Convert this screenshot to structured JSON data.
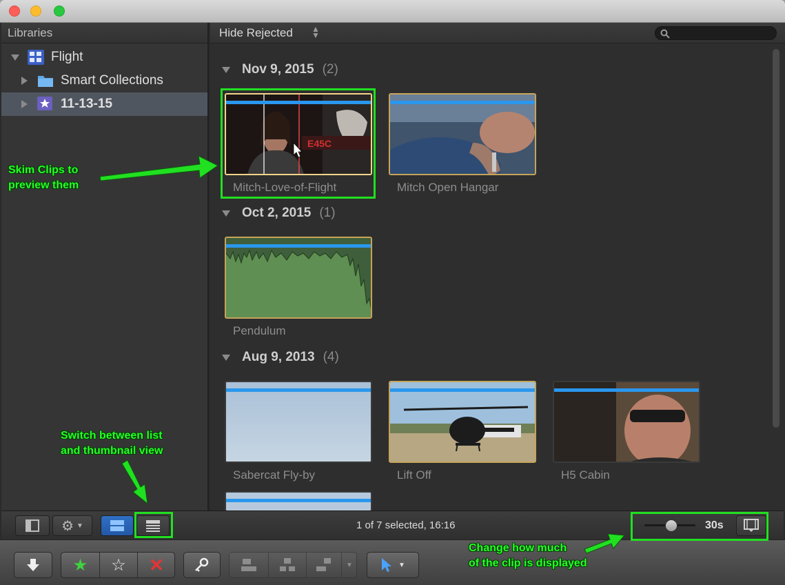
{
  "sidebar": {
    "header": "Libraries",
    "items": [
      {
        "label": "Flight",
        "icon": "library-icon",
        "expanded": true
      },
      {
        "label": "Smart Collections",
        "icon": "folder-icon",
        "expanded": false
      },
      {
        "label": "11-13-15",
        "icon": "event-star-icon",
        "expanded": false
      }
    ]
  },
  "browser": {
    "filter": "Hide Rejected",
    "search_placeholder": "",
    "groups": [
      {
        "date": "Nov 9, 2015",
        "count": "(2)",
        "clips": [
          "Mitch-Love-of-Flight",
          "Mitch Open Hangar"
        ]
      },
      {
        "date": "Oct 2, 2015",
        "count": "(1)",
        "clips": [
          "Pendulum"
        ]
      },
      {
        "date": "Aug 9, 2013",
        "count": "(4)",
        "clips": [
          "Sabercat Fly-by",
          "Lift Off",
          "H5 Cabin"
        ]
      }
    ]
  },
  "bottombar": {
    "status": "1 of 7 selected, 16:16",
    "duration": "30s"
  },
  "annotations": {
    "skim_line1": "Skim Clips to",
    "skim_line2": "preview them",
    "switch_line1": "Switch between list",
    "switch_line2": "and thumbnail view",
    "change_line1": "Change how much",
    "change_line2": "of the clip is displayed"
  },
  "colors": {
    "annotation": "#21e021",
    "clip_border": "#c7a45a",
    "skim_bar": "#2a97ee",
    "selected_row": "#50565f"
  }
}
